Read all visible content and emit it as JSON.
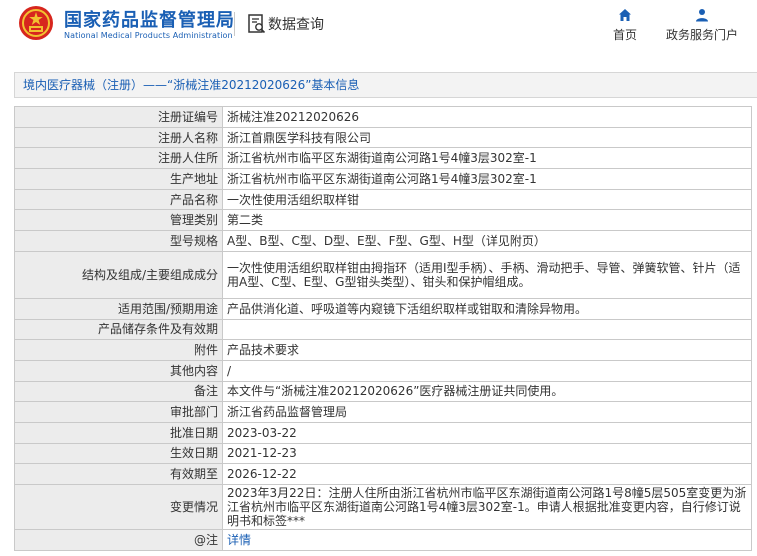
{
  "header": {
    "org_name_cn": "国家药品监督管理局",
    "org_name_en": "National Medical Products Administration",
    "data_query_label": "数据查询",
    "nav": [
      {
        "label": "首页",
        "icon": "home-icon"
      },
      {
        "label": "政务服务门户",
        "icon": "user-icon"
      }
    ]
  },
  "breadcrumb_title": "境内医疗器械（注册）——“浙械注准20212020626”基本信息",
  "colors": {
    "brand_blue": "#1a5fb4",
    "label_bg": "#ececec",
    "title_bg": "#f3f3f3",
    "border": "#c9c9c9"
  },
  "rows": [
    {
      "label": "注册证编号",
      "value": "浙械注准20212020626"
    },
    {
      "label": "注册人名称",
      "value": "浙江首鼎医学科技有限公司"
    },
    {
      "label": "注册人住所",
      "value": "浙江省杭州市临平区东湖街道南公河路1号4幢3层302室-1"
    },
    {
      "label": "生产地址",
      "value": "浙江省杭州市临平区东湖街道南公河路1号4幢3层302室-1"
    },
    {
      "label": "产品名称",
      "value": "一次性使用活组织取样钳"
    },
    {
      "label": "管理类别",
      "value": "第二类"
    },
    {
      "label": "型号规格",
      "value": "A型、B型、C型、D型、E型、F型、G型、H型（详见附页）"
    },
    {
      "label": "结构及组成/主要组成成分",
      "value": "一次性使用活组织取样钳由拇指环（适用I型手柄）、手柄、滑动把手、导管、弹簧软管、针片（适用A型、C型、E型、G型钳头类型）、钳头和保护帽组成。"
    },
    {
      "label": "适用范围/预期用途",
      "value": "产品供消化道、呼吸道等内窥镜下活组织取样或钳取和清除异物用。"
    },
    {
      "label": "产品储存条件及有效期",
      "value": ""
    },
    {
      "label": "附件",
      "value": "产品技术要求"
    },
    {
      "label": "其他内容",
      "value": "/"
    },
    {
      "label": "备注",
      "value": "本文件与“浙械注准20212020626”医疗器械注册证共同使用。"
    },
    {
      "label": "审批部门",
      "value": "浙江省药品监督管理局"
    },
    {
      "label": "批准日期",
      "value": "2023-03-22"
    },
    {
      "label": "生效日期",
      "value": "2021-12-23"
    },
    {
      "label": "有效期至",
      "value": "2026-12-22"
    },
    {
      "label": "变更情况",
      "value": "2023年3月22日：注册人住所由浙江省杭州市临平区东湖街道南公河路1号8幢5层505室变更为浙江省杭州市临平区东湖街道南公河路1号4幢3层302室-1。申请人根据批准变更内容，自行修订说明书和标签***"
    },
    {
      "label": "@注",
      "value": "详情"
    }
  ]
}
